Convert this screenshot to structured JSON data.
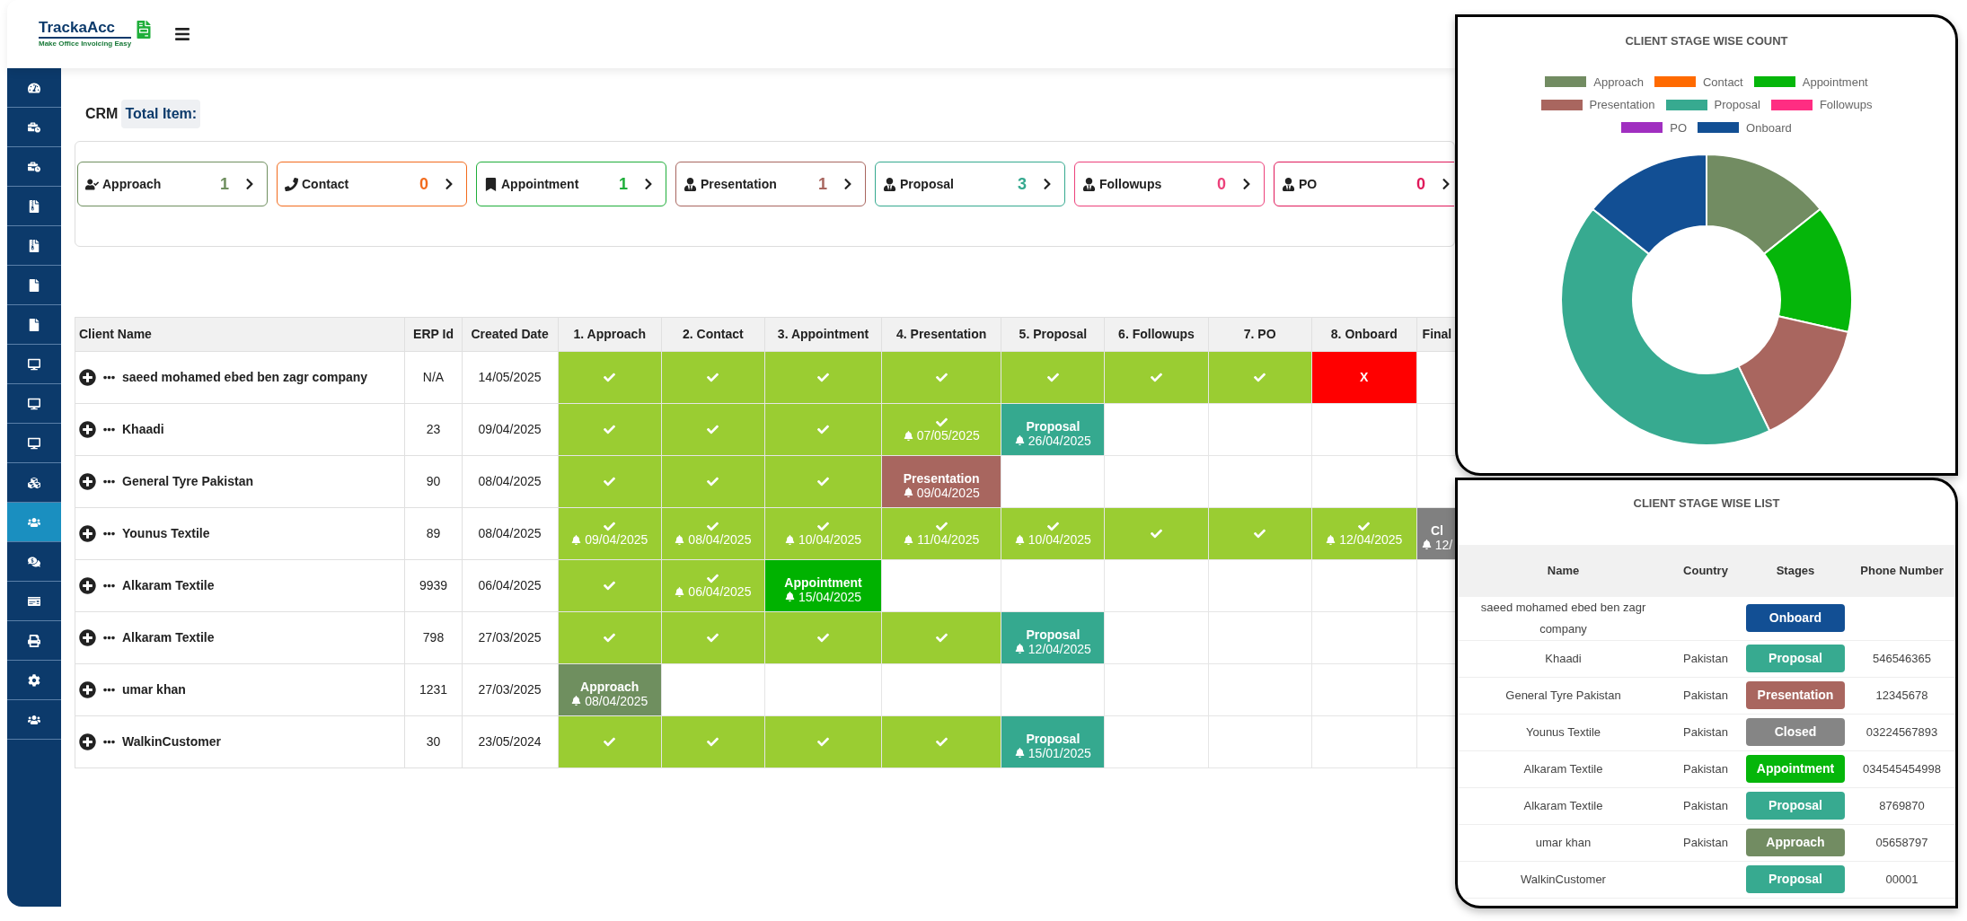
{
  "header": {
    "logo": "TrackaAcc",
    "tagline": "Make Office Invoicing Easy"
  },
  "sidebar": {
    "items": [
      {
        "selected": false
      },
      {
        "selected": false
      },
      {
        "selected": false
      },
      {
        "selected": false
      },
      {
        "selected": false
      },
      {
        "selected": false
      },
      {
        "selected": false
      },
      {
        "selected": false
      },
      {
        "selected": false
      },
      {
        "selected": false
      },
      {
        "selected": false
      },
      {
        "selected": true
      },
      {
        "selected": false
      },
      {
        "selected": false
      },
      {
        "selected": false
      },
      {
        "selected": false
      },
      {
        "selected": false
      }
    ]
  },
  "page": {
    "title": "CRM",
    "total_label": "Total Item:"
  },
  "stage_cards": [
    {
      "label": "Approach",
      "count": "1",
      "color": "#6f8f5f"
    },
    {
      "label": "Contact",
      "count": "0",
      "color": "#f26b1d"
    },
    {
      "label": "Appointment",
      "count": "1",
      "color": "#1fae3a"
    },
    {
      "label": "Presentation",
      "count": "1",
      "color": "#a8665f"
    },
    {
      "label": "Proposal",
      "count": "3",
      "color": "#35a98f"
    },
    {
      "label": "Followups",
      "count": "0",
      "color": "#ec407a"
    },
    {
      "label": "PO",
      "count": "0",
      "color": "#e0195a"
    }
  ],
  "table": {
    "columns": [
      "Client Name",
      "ERP Id",
      "Created Date",
      "1. Approach",
      "2. Contact",
      "3. Appointment",
      "4. Presentation",
      "5. Proposal",
      "6. Followups",
      "7. PO",
      "8. Onboard",
      "Final"
    ],
    "rows": [
      {
        "name": "saeed mohamed ebed ben zagr company",
        "erp_id": "N/A",
        "created": "14/05/2025",
        "stages": [
          {
            "kind": "check"
          },
          {
            "kind": "check"
          },
          {
            "kind": "check"
          },
          {
            "kind": "check"
          },
          {
            "kind": "check"
          },
          {
            "kind": "check"
          },
          {
            "kind": "check"
          },
          {
            "kind": "cross",
            "mark": "X"
          },
          {
            "kind": "empty"
          }
        ]
      },
      {
        "name": "Khaadi",
        "erp_id": "23",
        "created": "09/04/2025",
        "stages": [
          {
            "kind": "check"
          },
          {
            "kind": "check"
          },
          {
            "kind": "check"
          },
          {
            "kind": "check",
            "date": "07/05/2025"
          },
          {
            "kind": "current",
            "label": "Proposal",
            "date": "26/04/2025",
            "color": "#35a98f"
          },
          {
            "kind": "empty"
          },
          {
            "kind": "empty"
          },
          {
            "kind": "empty"
          },
          {
            "kind": "empty"
          }
        ]
      },
      {
        "name": "General Tyre Pakistan",
        "erp_id": "90",
        "created": "08/04/2025",
        "stages": [
          {
            "kind": "check"
          },
          {
            "kind": "check"
          },
          {
            "kind": "check"
          },
          {
            "kind": "current",
            "label": "Presentation",
            "date": "09/04/2025",
            "color": "#a8665f"
          },
          {
            "kind": "empty"
          },
          {
            "kind": "empty"
          },
          {
            "kind": "empty"
          },
          {
            "kind": "empty"
          },
          {
            "kind": "empty"
          }
        ]
      },
      {
        "name": "Younus Textile",
        "erp_id": "89",
        "created": "08/04/2025",
        "stages": [
          {
            "kind": "check",
            "date": "09/04/2025"
          },
          {
            "kind": "check",
            "date": "08/04/2025"
          },
          {
            "kind": "check",
            "date": "10/04/2025"
          },
          {
            "kind": "check",
            "date": "11/04/2025"
          },
          {
            "kind": "check",
            "date": "10/04/2025"
          },
          {
            "kind": "check"
          },
          {
            "kind": "check"
          },
          {
            "kind": "check",
            "date": "12/04/2025"
          },
          {
            "kind": "current",
            "label": "Cl",
            "date": "12/",
            "color": "#808080"
          }
        ]
      },
      {
        "name": "Alkaram Textile",
        "erp_id": "9939",
        "created": "06/04/2025",
        "stages": [
          {
            "kind": "check"
          },
          {
            "kind": "check",
            "date": "06/04/2025"
          },
          {
            "kind": "current",
            "label": "Appointment",
            "date": "15/04/2025",
            "color": "#00b200"
          },
          {
            "kind": "empty"
          },
          {
            "kind": "empty"
          },
          {
            "kind": "empty"
          },
          {
            "kind": "empty"
          },
          {
            "kind": "empty"
          },
          {
            "kind": "empty"
          }
        ]
      },
      {
        "name": "Alkaram Textile",
        "erp_id": "798",
        "created": "27/03/2025",
        "stages": [
          {
            "kind": "check"
          },
          {
            "kind": "check"
          },
          {
            "kind": "check"
          },
          {
            "kind": "check"
          },
          {
            "kind": "current",
            "label": "Proposal",
            "date": "12/04/2025",
            "color": "#35a98f"
          },
          {
            "kind": "empty"
          },
          {
            "kind": "empty"
          },
          {
            "kind": "empty"
          },
          {
            "kind": "empty"
          }
        ]
      },
      {
        "name": "umar khan",
        "erp_id": "1231",
        "created": "27/03/2025",
        "stages": [
          {
            "kind": "current",
            "label": "Approach",
            "date": "08/04/2025",
            "color": "#6f8f5f"
          },
          {
            "kind": "empty"
          },
          {
            "kind": "empty"
          },
          {
            "kind": "empty"
          },
          {
            "kind": "empty"
          },
          {
            "kind": "empty"
          },
          {
            "kind": "empty"
          },
          {
            "kind": "empty"
          },
          {
            "kind": "empty"
          }
        ]
      },
      {
        "name": "WalkinCustomer",
        "erp_id": "30",
        "created": "23/05/2024",
        "stages": [
          {
            "kind": "check"
          },
          {
            "kind": "check"
          },
          {
            "kind": "check"
          },
          {
            "kind": "check"
          },
          {
            "kind": "current",
            "label": "Proposal",
            "date": "15/01/2025",
            "color": "#35a98f"
          },
          {
            "kind": "empty"
          },
          {
            "kind": "empty"
          },
          {
            "kind": "empty"
          },
          {
            "kind": "empty"
          }
        ]
      }
    ]
  },
  "count_panel": {
    "legend": [
      {
        "color": "#728c62"
      },
      {
        "color": "#ff6a00"
      },
      {
        "color": "#05b60a"
      },
      {
        "color": "#a9665f"
      },
      {
        "color": "#37aa90"
      },
      {
        "color": "#ff2d82"
      },
      {
        "color": "#a02fc0"
      },
      {
        "color": "#124f94"
      }
    ],
    "chart_data": {
      "type": "donut",
      "title": "CLIENT STAGE WISE COUNT",
      "categories": [
        "Approach",
        "Contact",
        "Appointment",
        "Presentation",
        "Proposal",
        "Followups",
        "PO",
        "Onboard"
      ],
      "values": [
        14.28,
        0,
        14.29,
        14.29,
        42.86,
        0,
        0,
        14.28
      ]
    }
  },
  "list_panel": {
    "title": "CLIENT STAGE WISE LIST",
    "columns": [
      "Name",
      "Country",
      "Stages",
      "Phone Number"
    ],
    "rows": [
      {
        "name": "saeed mohamed ebed ben zagr company",
        "stage": {
          "label": "Onboard",
          "color": "#124f94"
        }
      },
      {
        "name": "Khaadi",
        "country": "Pakistan",
        "stage": {
          "label": "Proposal",
          "color": "#37aa90"
        },
        "phone": "546546365"
      },
      {
        "name": "General Tyre Pakistan",
        "country": "Pakistan",
        "stage": {
          "label": "Presentation",
          "color": "#a9665f"
        },
        "phone": "12345678"
      },
      {
        "name": "Younus Textile",
        "country": "Pakistan",
        "stage": {
          "label": "Closed",
          "color": "#858585"
        },
        "phone": "03224567893"
      },
      {
        "name": "Alkaram Textile",
        "country": "Pakistan",
        "stage": {
          "label": "Appointment",
          "color": "#05b60a"
        },
        "phone": "034545454998"
      },
      {
        "name": "Alkaram Textile",
        "country": "Pakistan",
        "stage": {
          "label": "Proposal",
          "color": "#37aa90"
        },
        "phone": "8769870"
      },
      {
        "name": "umar khan",
        "country": "Pakistan",
        "stage": {
          "label": "Approach",
          "color": "#728c62"
        },
        "phone": "05658797"
      },
      {
        "name": "WalkinCustomer",
        "stage": {
          "label": "Proposal",
          "color": "#37aa90"
        },
        "phone": "00001"
      }
    ]
  }
}
